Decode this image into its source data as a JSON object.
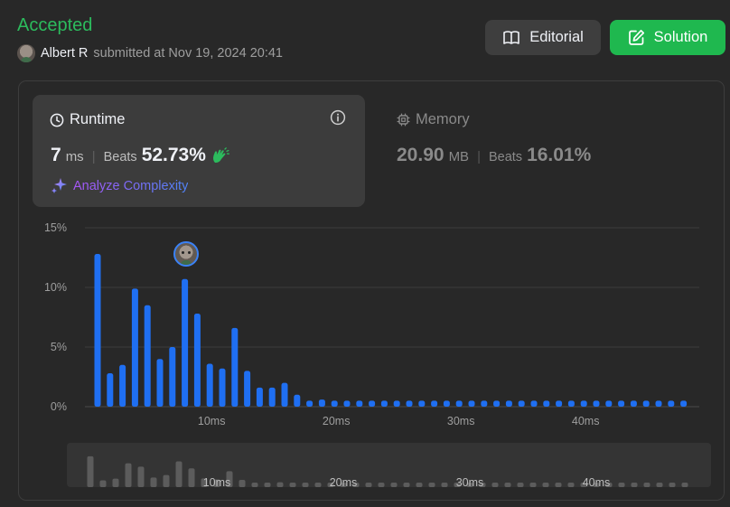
{
  "header": {
    "status": "Accepted",
    "user": "Albert R",
    "submitted_text": "submitted at Nov 19, 2024 20:41",
    "editorial_label": "Editorial",
    "solution_label": "Solution"
  },
  "runtime": {
    "title": "Runtime",
    "value": "7",
    "unit": "ms",
    "beats_label": "Beats",
    "beats_value": "52.73%",
    "analyze_label": "Analyze Complexity"
  },
  "memory": {
    "title": "Memory",
    "value": "20.90",
    "unit": "MB",
    "beats_label": "Beats",
    "beats_value": "16.01%"
  },
  "colors": {
    "accepted": "#2cbb5d",
    "bar": "#1f6ff2",
    "solution_button": "#1fb84f",
    "mini_bar": "#5c5c5c"
  },
  "chart_data": {
    "type": "bar",
    "y_tick_labels": [
      "15%",
      "10%",
      "5%",
      "0%"
    ],
    "ylim": [
      0,
      15
    ],
    "x_tick_labels": [
      "10ms",
      "20ms",
      "30ms",
      "40ms"
    ],
    "x_tick_values": [
      10,
      20,
      30,
      40
    ],
    "bin_range_ms": [
      1,
      48
    ],
    "highlighted_bin_ms": 8,
    "grid": true,
    "values": [
      12.8,
      2.8,
      3.5,
      9.9,
      8.5,
      4.0,
      5.0,
      10.7,
      7.8,
      3.6,
      3.2,
      6.6,
      3.0,
      1.6,
      1.6,
      2.0,
      1.0,
      0.5,
      0.6,
      0.5,
      0.5,
      0.5,
      0.5,
      0.5,
      0.5,
      0.5,
      0.5,
      0.5,
      0.5,
      0.5,
      0.5,
      0.5,
      0.5,
      0.5,
      0.5,
      0.5,
      0.5,
      0.5,
      0.5,
      0.5,
      0.5,
      0.5,
      0.5,
      0.5,
      0.5,
      0.5,
      0.5,
      0.5
    ]
  }
}
